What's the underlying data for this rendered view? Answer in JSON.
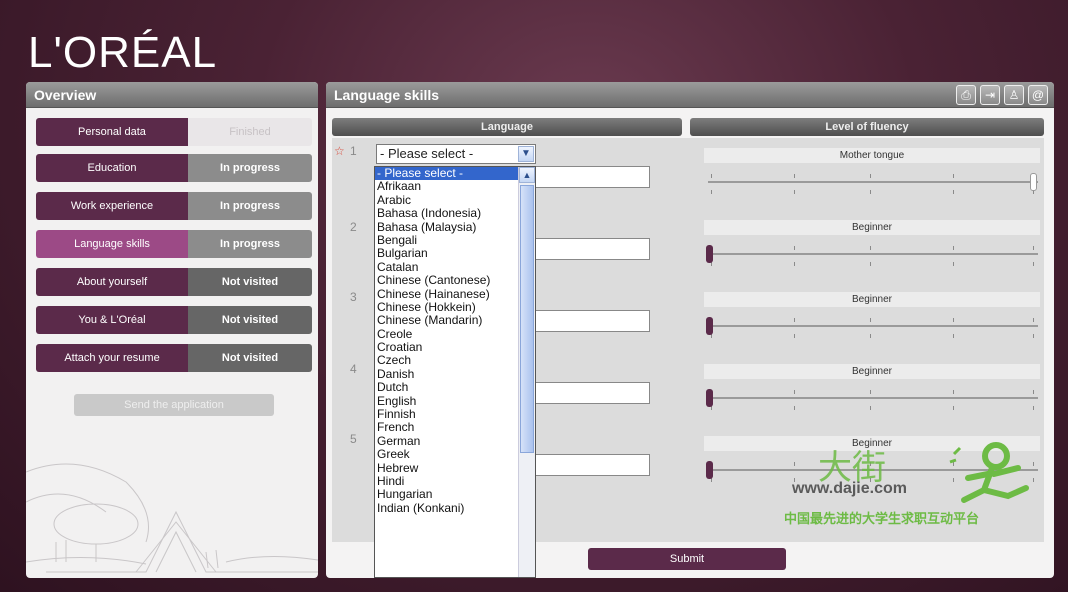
{
  "brand": {
    "logo": "L'ORÉAL"
  },
  "overview": {
    "title": "Overview",
    "steps": [
      {
        "name": "Personal data",
        "status": "Finished"
      },
      {
        "name": "Education",
        "status": "In progress"
      },
      {
        "name": "Work experience",
        "status": "In progress"
      },
      {
        "name": "Language skills",
        "status": "In progress"
      },
      {
        "name": "About yourself",
        "status": "Not visited"
      },
      {
        "name": "You & L'Oréal",
        "status": "Not visited"
      },
      {
        "name": "Attach your resume",
        "status": "Not visited"
      }
    ],
    "send_label": "Send the application"
  },
  "skills": {
    "title": "Language skills",
    "header_icons": [
      "print-icon",
      "export-icon",
      "person-icon",
      "email-icon"
    ],
    "col_language": "Language",
    "col_fluency": "Level of fluency",
    "required_mark": "☆",
    "rows": [
      {
        "num": "1",
        "fluency": "Mother tongue",
        "level_fraction": 1.0
      },
      {
        "num": "2",
        "fluency": "Beginner",
        "level_fraction": 0.0
      },
      {
        "num": "3",
        "fluency": "Beginner",
        "level_fraction": 0.0
      },
      {
        "num": "4",
        "fluency": "Beginner",
        "level_fraction": 0.0
      },
      {
        "num": "5",
        "fluency": "Beginner",
        "level_fraction": 0.0
      }
    ],
    "select_value": "- Please select -",
    "dropdown_options": [
      "- Please select -",
      "Afrikaan",
      "Arabic",
      "Bahasa (Indonesia)",
      "Bahasa (Malaysia)",
      "Bengali",
      "Bulgarian",
      "Catalan",
      "Chinese (Cantonese)",
      "Chinese (Hainanese)",
      "Chinese (Hokkein)",
      "Chinese (Mandarin)",
      "Creole",
      "Croatian",
      "Czech",
      "Danish",
      "Dutch",
      "English",
      "Finnish",
      "French",
      "German",
      "Greek",
      "Hebrew",
      "Hindi",
      "Hungarian",
      "Indian (Konkani)"
    ],
    "submit_label": "Submit"
  },
  "watermark": {
    "big": "大街",
    "url": "www.dajie.com",
    "tagline": "中国最先进的大学生求职互动平台"
  },
  "colors": {
    "brand_purple": "#5b2a4a",
    "active_purple": "#9c4a86",
    "knob_purple": "#5b2a4a",
    "select_blue": "#3366cc",
    "watermark_green": "#6dbb45"
  }
}
